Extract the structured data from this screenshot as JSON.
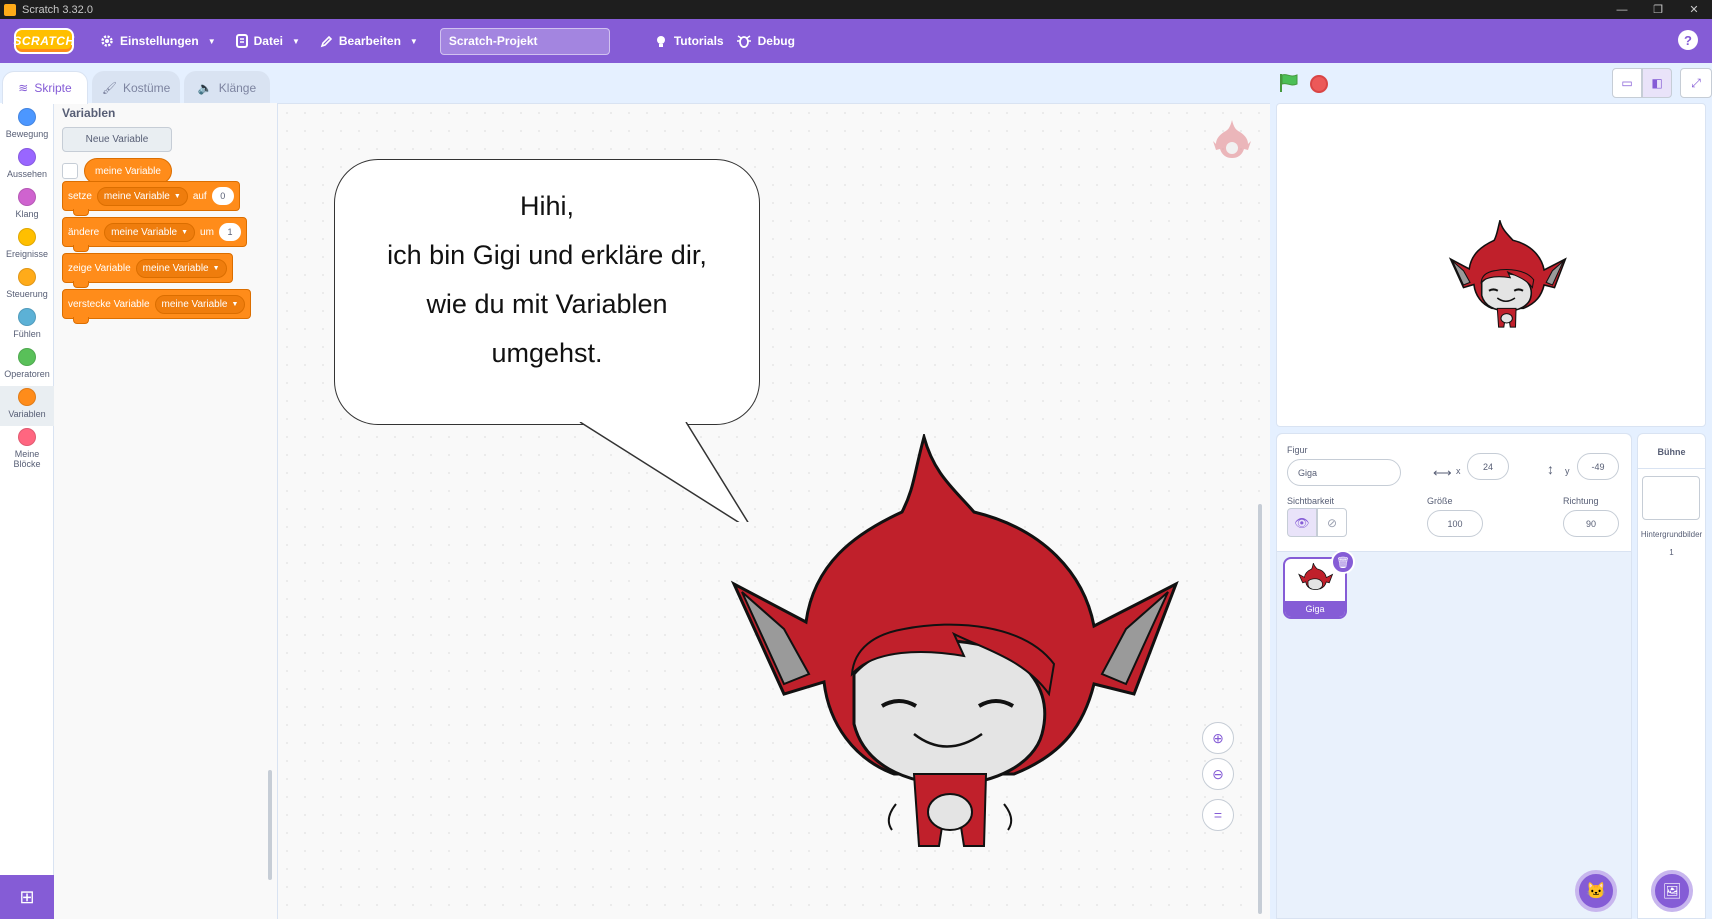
{
  "window": {
    "title": "Scratch 3.32.0"
  },
  "menu": {
    "logo": "SCRATCH",
    "settings": "Einstellungen",
    "file": "Datei",
    "edit": "Bearbeiten",
    "project_title": "Scratch-Projekt",
    "tutorials": "Tutorials",
    "debug": "Debug",
    "help": "?"
  },
  "tabs": [
    {
      "label": "Skripte",
      "active": true
    },
    {
      "label": "Kostüme",
      "active": false
    },
    {
      "label": "Klänge",
      "active": false
    }
  ],
  "categories": [
    {
      "label": "Bewegung",
      "color": "#4c97ff"
    },
    {
      "label": "Aussehen",
      "color": "#9966ff"
    },
    {
      "label": "Klang",
      "color": "#cf63cf"
    },
    {
      "label": "Ereignisse",
      "color": "#ffbf00"
    },
    {
      "label": "Steuerung",
      "color": "#ffab19"
    },
    {
      "label": "Fühlen",
      "color": "#5cb1d6"
    },
    {
      "label": "Operatoren",
      "color": "#59c059"
    },
    {
      "label": "Variablen",
      "color": "#ff8c1a"
    },
    {
      "label": "Meine Blöcke",
      "color": "#ff6680"
    }
  ],
  "palette": {
    "heading": "Variablen",
    "new_variable_button": "Neue Variable",
    "variable_reporter": "meine Variable",
    "blocks": {
      "set": {
        "verb": "setze",
        "var": "meine Variable",
        "prep": "auf",
        "value": "0"
      },
      "change": {
        "verb": "ändere",
        "var": "meine Variable",
        "prep": "um",
        "value": "1"
      },
      "show": {
        "verb": "zeige Variable",
        "var": "meine Variable"
      },
      "hide": {
        "verb": "verstecke Variable",
        "var": "meine Variable"
      }
    }
  },
  "speech": {
    "line1": "Hihi,",
    "line2": "ich bin Gigi und erkläre dir,",
    "line3": "wie du mit Variablen",
    "line4": "umgehst."
  },
  "zoom": {
    "in": "+",
    "out": "−",
    "reset": "="
  },
  "sprite_info": {
    "sprite_label": "Figur",
    "sprite_name": "Giga",
    "x_label": "x",
    "x": "24",
    "y_label": "y",
    "y": "-49",
    "visibility_label": "Sichtbarkeit",
    "size_label": "Größe",
    "size": "100",
    "direction_label": "Richtung",
    "direction": "90"
  },
  "sprite_list": [
    {
      "name": "Giga",
      "selected": true
    }
  ],
  "stage_pane": {
    "title": "Bühne",
    "backdrops_label": "Hintergrundbilder",
    "backdrops_count": "1"
  },
  "colors": {
    "brand": "#855cd6",
    "variables": "#ff8c1a",
    "giga_red": "#c0202b"
  }
}
